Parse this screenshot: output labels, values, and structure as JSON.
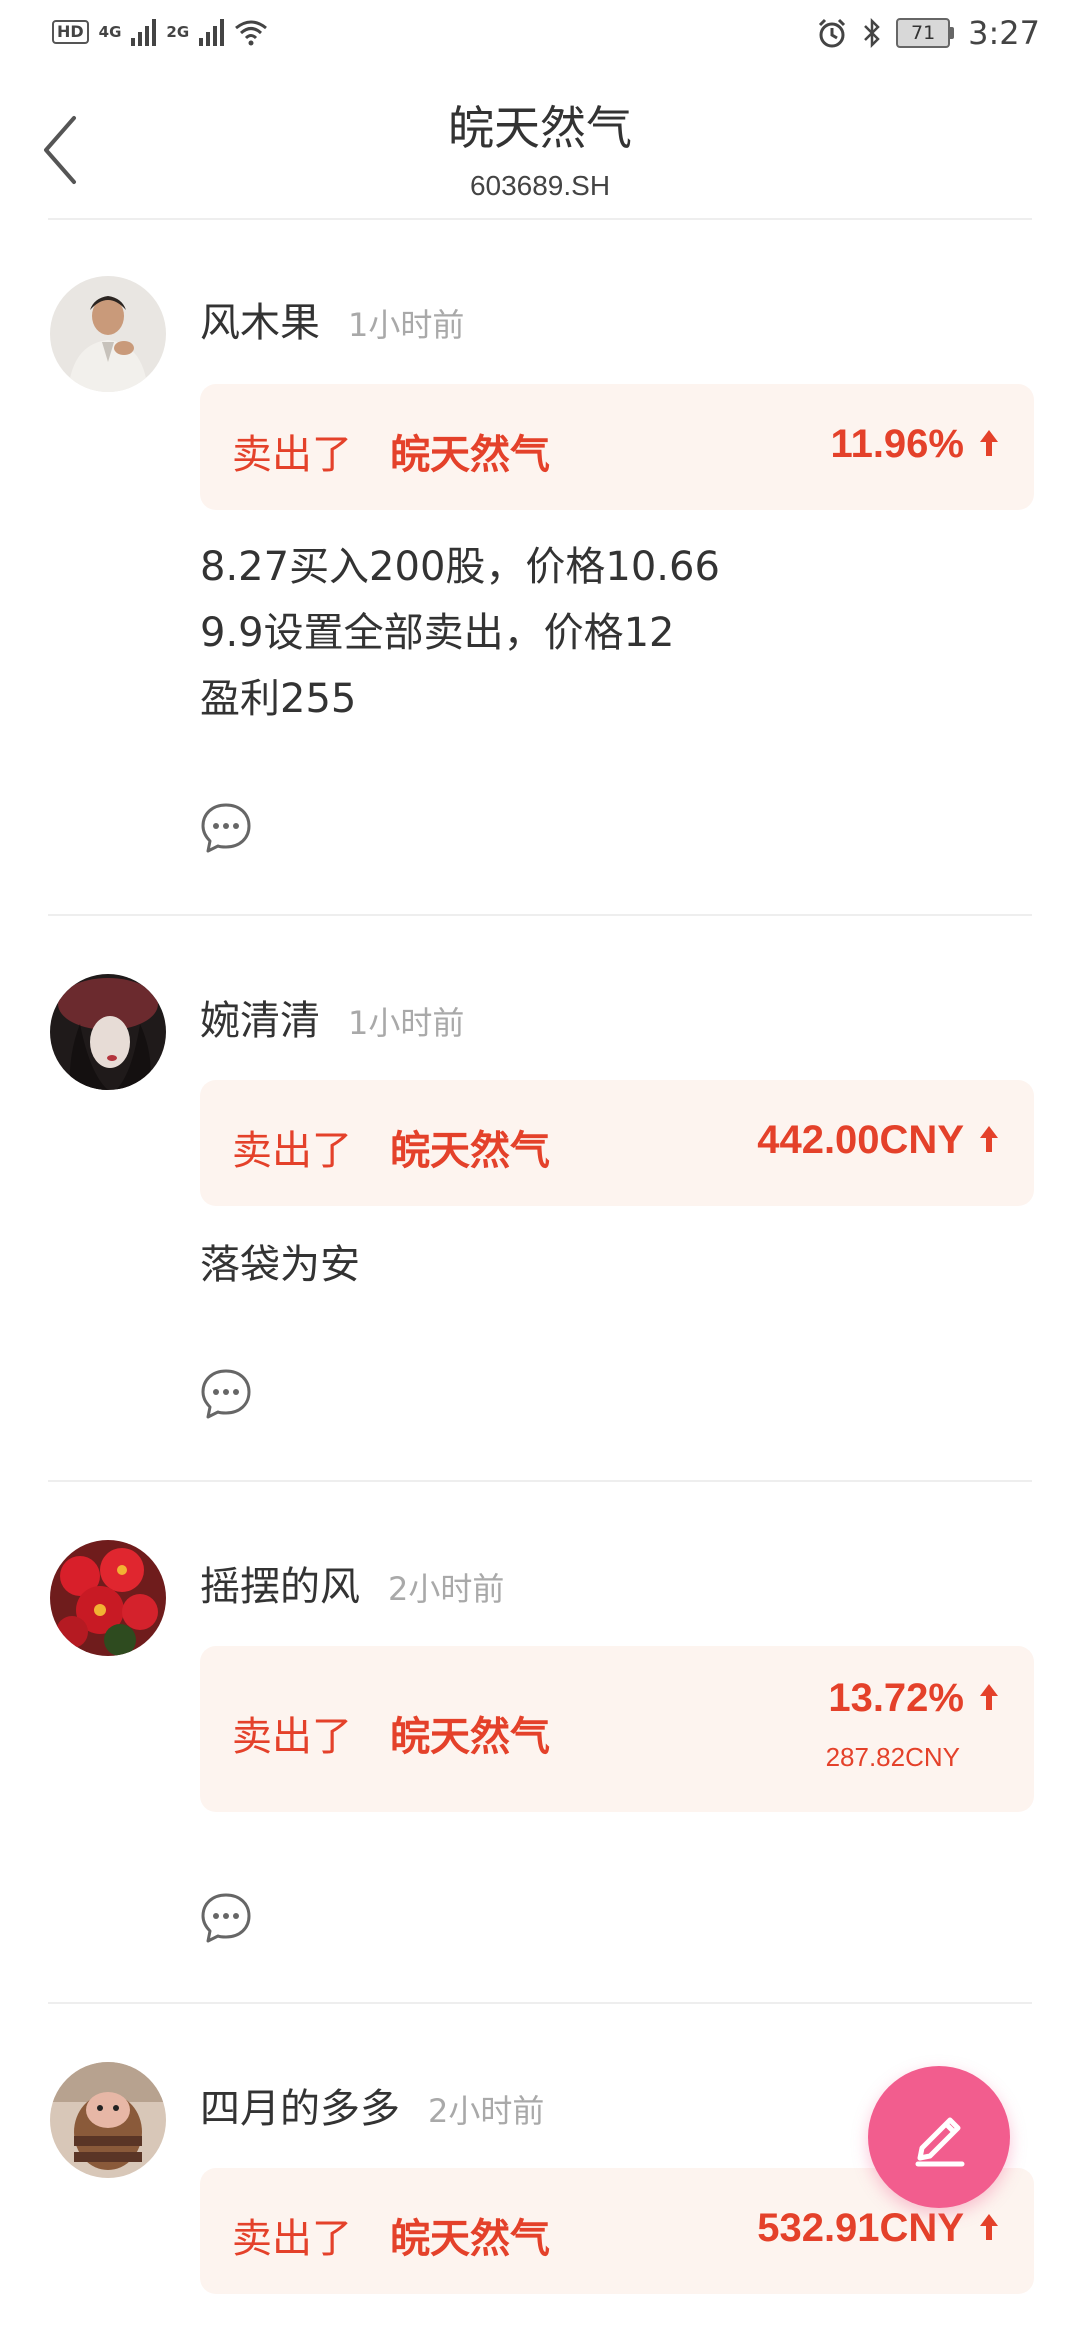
{
  "status_bar": {
    "hd": "HD",
    "net1": "4G",
    "net2": "2G",
    "battery": "71",
    "time": "3:27"
  },
  "header": {
    "title": "皖天然气",
    "subtitle": "603689.SH"
  },
  "posts": [
    {
      "name": "风木果",
      "time": "1小时前",
      "action": "卖出了",
      "stock": "皖天然气",
      "value": "11.96%",
      "sub_value": "",
      "content": [
        "8.27买入200股，价格10.66",
        "9.9设置全部卖出，价格12",
        "盈利255"
      ]
    },
    {
      "name": "婉清清",
      "time": "1小时前",
      "action": "卖出了",
      "stock": "皖天然气",
      "value": "442.00CNY",
      "sub_value": "",
      "content": [
        "落袋为安"
      ]
    },
    {
      "name": "摇摆的风",
      "time": "2小时前",
      "action": "卖出了",
      "stock": "皖天然气",
      "value": "13.72%",
      "sub_value": "287.82CNY",
      "content": []
    },
    {
      "name": "四月的多多",
      "time": "2小时前",
      "action": "卖出了",
      "stock": "皖天然气",
      "value": "532.91CNY",
      "sub_value": "",
      "content": []
    }
  ],
  "colors": {
    "accent_red": "#e4412a",
    "card_bg": "#fdf4ef",
    "fab_pink": "#f25d8e"
  },
  "icons": {
    "back": "chevron-left-icon",
    "comment": "comment-bubble-icon",
    "arrow": "up-arrow-icon",
    "fab": "pencil-icon"
  }
}
